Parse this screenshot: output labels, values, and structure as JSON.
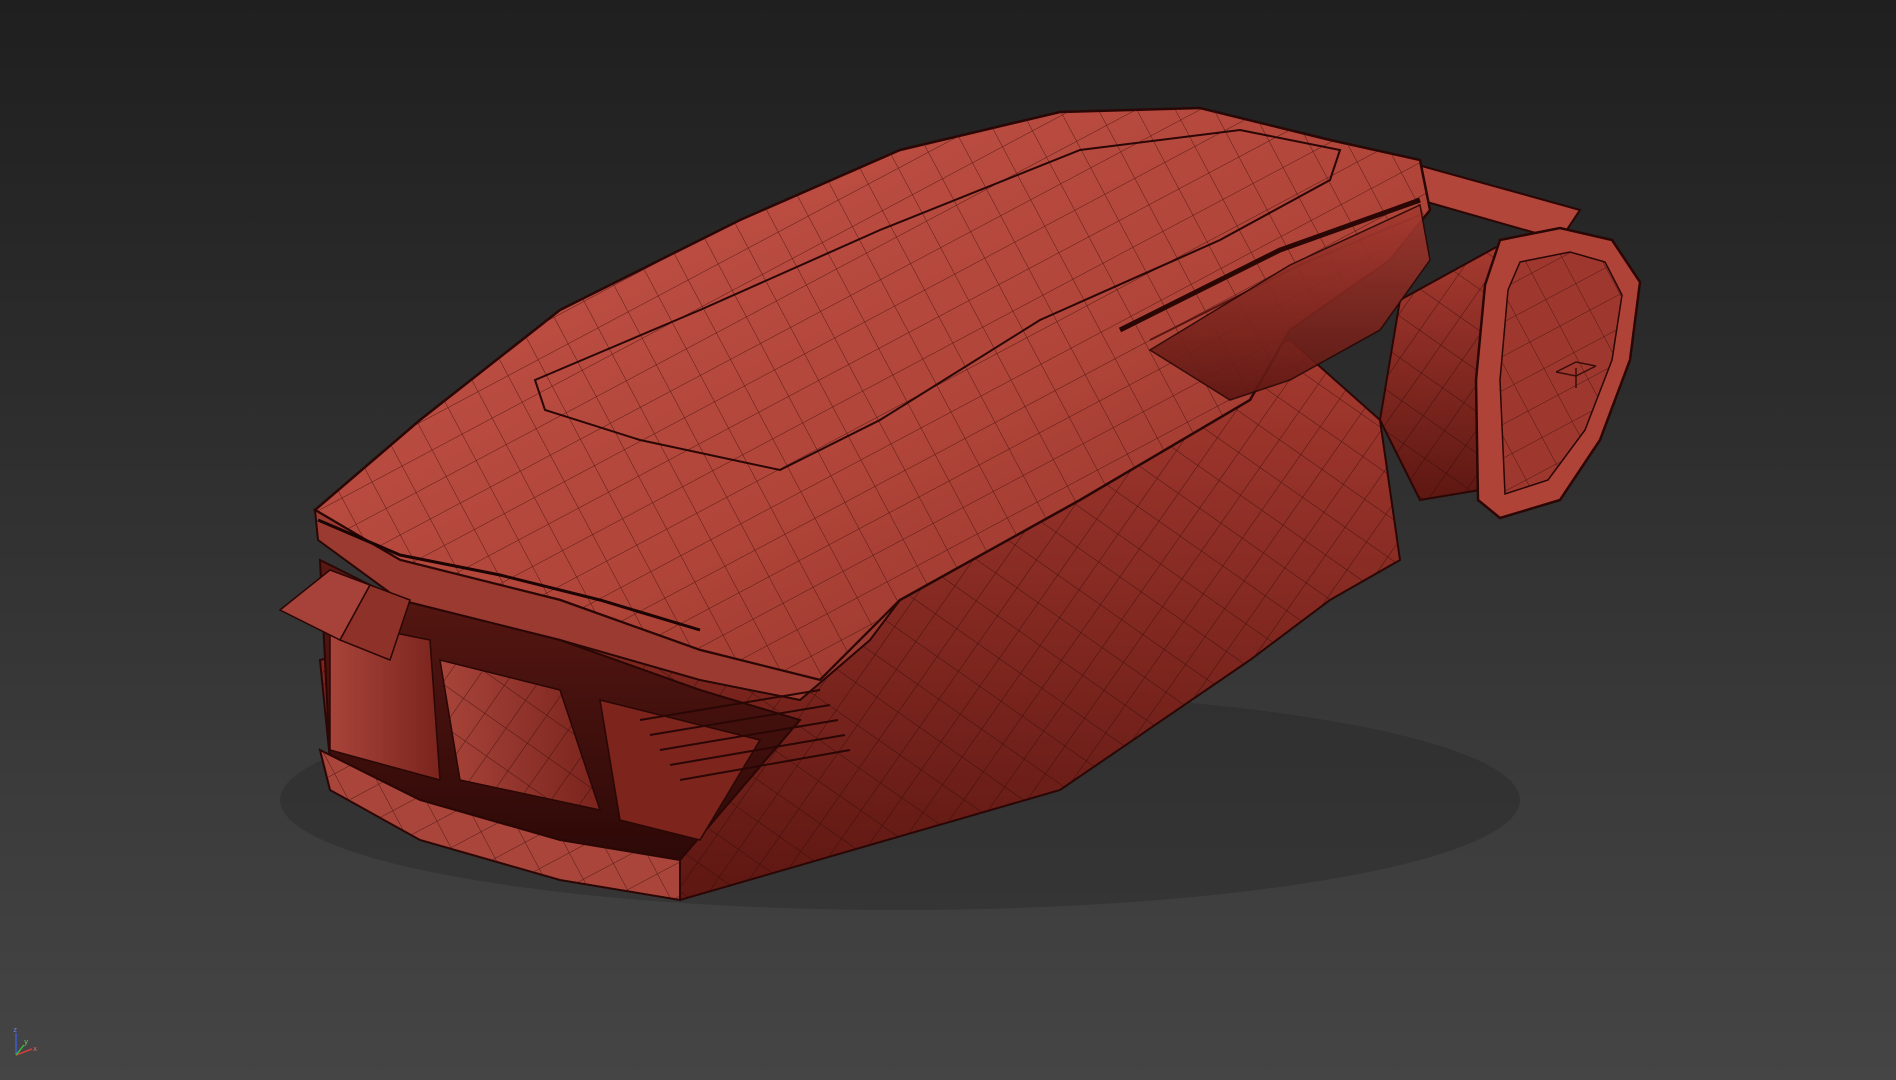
{
  "viewport": {
    "name": "perspective-viewport",
    "background_top": "#1f1f1f",
    "background_bottom": "#454545",
    "model_color": "#b5473d",
    "model_shadow_color": "#6e1c17",
    "wire_color": "#3a0d0a"
  },
  "axis_gizmo": {
    "x_label": "x",
    "y_label": "y",
    "z_label": "z",
    "x_color": "#d23c3c",
    "y_color": "#3cb43c",
    "z_color": "#3c5ad2"
  }
}
